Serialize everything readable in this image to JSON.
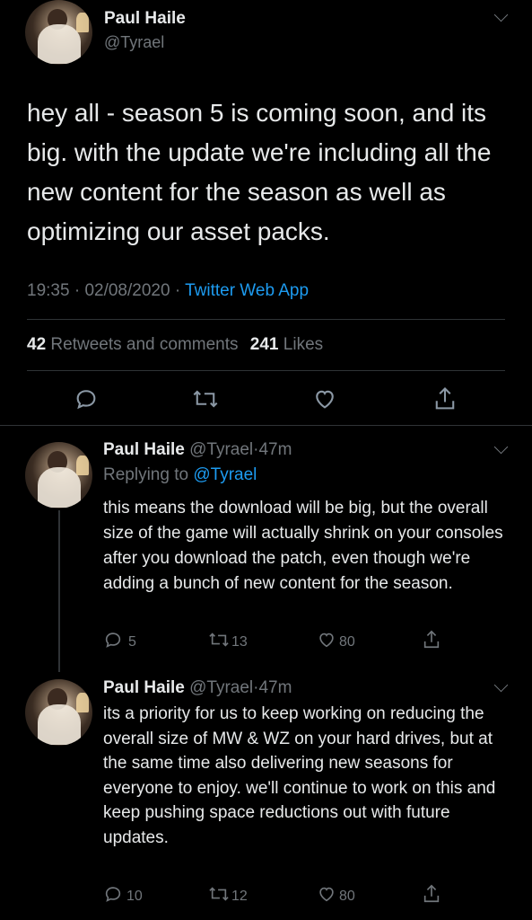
{
  "main_tweet": {
    "author_name": "Paul Haile",
    "author_handle": "@Tyrael",
    "text": "hey all - season 5 is coming soon, and its big.  with the update we're including all the new content for the season as well as optimizing our asset packs.",
    "time": "19:35",
    "date": "02/08/2020",
    "sep": "·",
    "source": "Twitter Web App",
    "retweets_count": "42",
    "retweets_label": "Retweets and comments",
    "likes_count": "241",
    "likes_label": "Likes",
    "icons": [
      "reply-icon",
      "retweet-icon",
      "like-icon",
      "share-icon"
    ]
  },
  "replies": [
    {
      "author_name": "Paul Haile",
      "author_handle": "@Tyrael",
      "sep": "·",
      "age": "47m",
      "replying_prefix": "Replying to",
      "replying_handle": "@Tyrael",
      "text": "this means the download will be big, but the overall size of the game will actually shrink on your consoles after you download the patch, even though we're adding a bunch of new content for the season.",
      "reply_count": "5",
      "retweet_count": "13",
      "like_count": "80"
    },
    {
      "author_name": "Paul Haile",
      "author_handle": "@Tyrael",
      "sep": "·",
      "age": "47m",
      "text": "its a priority for us to keep working on reducing the overall size of MW & WZ on your hard drives, but at the same time also delivering new seasons for everyone to enjoy. we'll continue to work on this and keep pushing space reductions out with future updates.",
      "reply_count": "10",
      "retweet_count": "12",
      "like_count": "80"
    }
  ],
  "colors": {
    "background": "#000000",
    "text": "#e7e9ea",
    "muted": "#71767b",
    "link": "#1d9bf0",
    "divider": "#2f3336"
  }
}
